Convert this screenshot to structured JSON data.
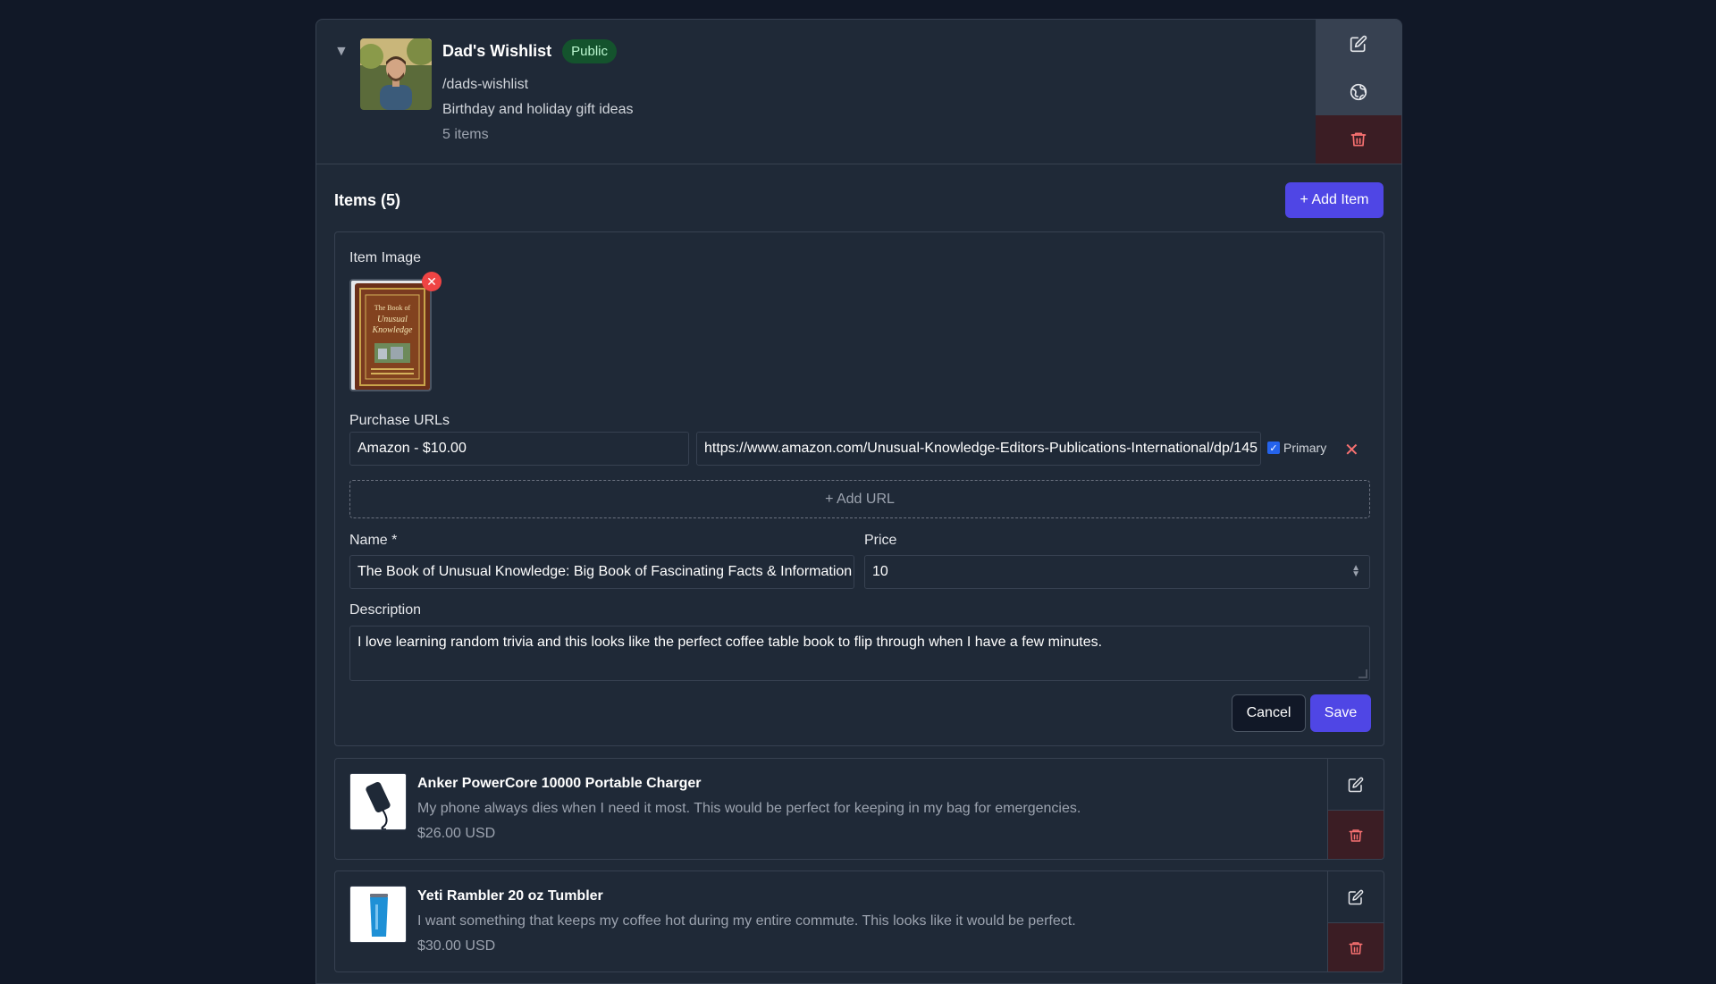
{
  "wishlist": {
    "title": "Dad's Wishlist",
    "visibility": "Public",
    "slug": "/dads-wishlist",
    "description": "Birthday and holiday gift ideas",
    "count_text": "5 items",
    "toggle_glyph": "▼",
    "actions": [
      "edit-icon",
      "globe-icon",
      "trash-icon"
    ]
  },
  "items_section": {
    "title": "Items (5)",
    "add_item_label": "+ Add Item"
  },
  "edit_form": {
    "image_label": "Item Image",
    "remove_image_glyph": "✕",
    "purchase_urls_label": "Purchase URLs",
    "url_label_value": "Amazon - $10.00",
    "url_value": "https://www.amazon.com/Unusual-Knowledge-Editors-Publications-International/dp/145",
    "primary_label": "Primary",
    "primary_checked": true,
    "remove_url_glyph": "✕",
    "add_url_label": "+ Add URL",
    "name_label": "Name *",
    "name_value": "The Book of Unusual Knowledge: Big Book of Fascinating Facts & Information",
    "price_label": "Price",
    "price_value": "10",
    "description_label": "Description",
    "description_value": "I love learning random trivia and this looks like the perfect coffee table book to flip through when I have a few minutes.",
    "cancel_label": "Cancel",
    "save_label": "Save"
  },
  "items": [
    {
      "name": "Anker PowerCore 10000 Portable Charger",
      "description": "My phone always dies when I need it most. This would be perfect for keeping in my bag for emergencies.",
      "price": "$26.00 USD"
    },
    {
      "name": "Yeti Rambler 20 oz Tumbler",
      "description": "I want something that keeps my coffee hot during my entire commute. This looks like it would be perfect.",
      "price": "$30.00 USD"
    }
  ],
  "colors": {
    "background": "#111827",
    "panel": "#1f2937",
    "accent": "#4f46e5",
    "public_badge": "#14532d",
    "danger": "#f87171"
  }
}
